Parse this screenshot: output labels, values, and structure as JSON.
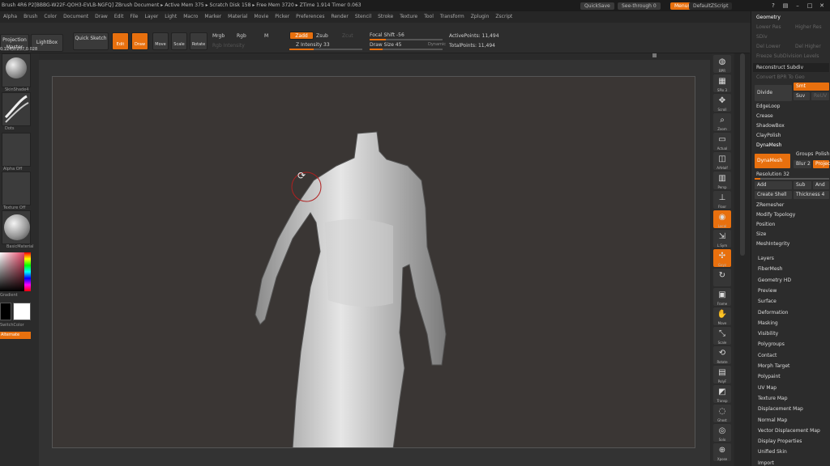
{
  "title": {
    "text": "Brush 4R6 P2[BBBG-W22F-QOH3-EVLB-NGFQ]   ZBrush Document      ▸ Active Mem 375 ▸ Scratch Disk 158 ▸ Free Mem 3720 ▸ ZTime 1.914 Timer 0.063",
    "quicksave": "QuickSave",
    "seethrough": "See-through  0",
    "menus": "Menus",
    "script": "DefaultZScript"
  },
  "menubar": [
    "Alpha",
    "Brush",
    "Color",
    "Document",
    "Draw",
    "Edit",
    "File",
    "Layer",
    "Light",
    "Macro",
    "Marker",
    "Material",
    "Movie",
    "Picker",
    "Preferences",
    "Render",
    "Stencil",
    "Stroke",
    "Texture",
    "Tool",
    "Transform",
    "Zplugin",
    "Zscript"
  ],
  "left": {
    "projection": "Projection",
    "master": "Master",
    "lightbox": "LightBox",
    "coords": "0.124,0.257,0.028",
    "brush_label": "SkinShade4",
    "stroke_label": "Dots",
    "alpha_label": "Alpha Off",
    "texture_label": "Texture Off",
    "material_label": "BasicMaterial",
    "gradient": "Gradient",
    "switchcolor": "SwitchColor",
    "alternate": "Alternate"
  },
  "toolbar": {
    "quick_sketch": "Quick Sketch",
    "edit": "Edit",
    "draw": "Draw",
    "move": "Move",
    "scale": "Scale",
    "rotate": "Rotate",
    "mrgb": "Mrgb",
    "rgb": "Rgb",
    "m": "M",
    "rgb_intensity": "Rgb Intensity",
    "zadd": "Zadd",
    "zsub": "Zsub",
    "zcut": "Zcut",
    "z_intensity": "Z Intensity 33",
    "focal_shift": "Focal Shift -56",
    "draw_size": "Draw Size 45",
    "dynamic": "Dynamic",
    "active_points": "ActivePoints: 11,494",
    "total_points": "TotalPoints: 11,494"
  },
  "right_tools": [
    "BPR",
    "SPix 3",
    "Scroll",
    "Zoom",
    "Actual",
    "AAHalf",
    "Persp",
    "Floor",
    "Local",
    "L.Sym",
    "Gxyz",
    "",
    "Frame",
    "Move",
    "Scale",
    "Rotate",
    "PolyF",
    "Transp",
    "Ghost",
    "Solo",
    "Xpose"
  ],
  "tray": {
    "header": "Geometry",
    "lower_res": "Lower Res",
    "higher_res": "Higher Res",
    "sdiv": "SDiv",
    "del_lower": "Del Lower",
    "del_higher": "Del Higher",
    "freeze": "Freeze SubDivision Levels",
    "reconstruct": "Reconstruct Subdiv",
    "convert_bpr": "Convert BPR To Geo",
    "divide": "Divide",
    "smt": "Smt",
    "suv": "Suv",
    "reuv": "ReUV",
    "edgeloop": "EdgeLoop",
    "crease": "Crease",
    "shadowbox": "ShadowBox",
    "claypolish": "ClayPolish",
    "dynamesh_hdr": "DynaMesh",
    "dynamesh_btn": "DynaMesh",
    "groups": "Groups",
    "polish": "Polish",
    "blur": "Blur 2",
    "project": "Project",
    "resolution": "Resolution 32",
    "add": "Add",
    "sub": "Sub",
    "and": "And",
    "create_shell": "Create Shell",
    "thickness": "Thickness 4",
    "zremesher": "ZRemesher",
    "modify_topology": "Modify Topology",
    "position": "Position",
    "size": "Size",
    "meshintegrity": "MeshIntegrity",
    "sections": [
      "Layers",
      "FiberMesh",
      "Geometry HD",
      "Preview",
      "Surface",
      "Deformation",
      "Masking",
      "Visibility",
      "Polygroups",
      "Contact",
      "Morph Target",
      "Polypaint",
      "UV Map",
      "Texture Map",
      "Displacement Map",
      "Normal Map",
      "Vector Displacement Map",
      "Display Properties",
      "Unified Skin",
      "Import"
    ]
  },
  "colors": {
    "accent": "#e8700e",
    "bg": "#2a2a2a",
    "canvas": "#3a3634"
  }
}
